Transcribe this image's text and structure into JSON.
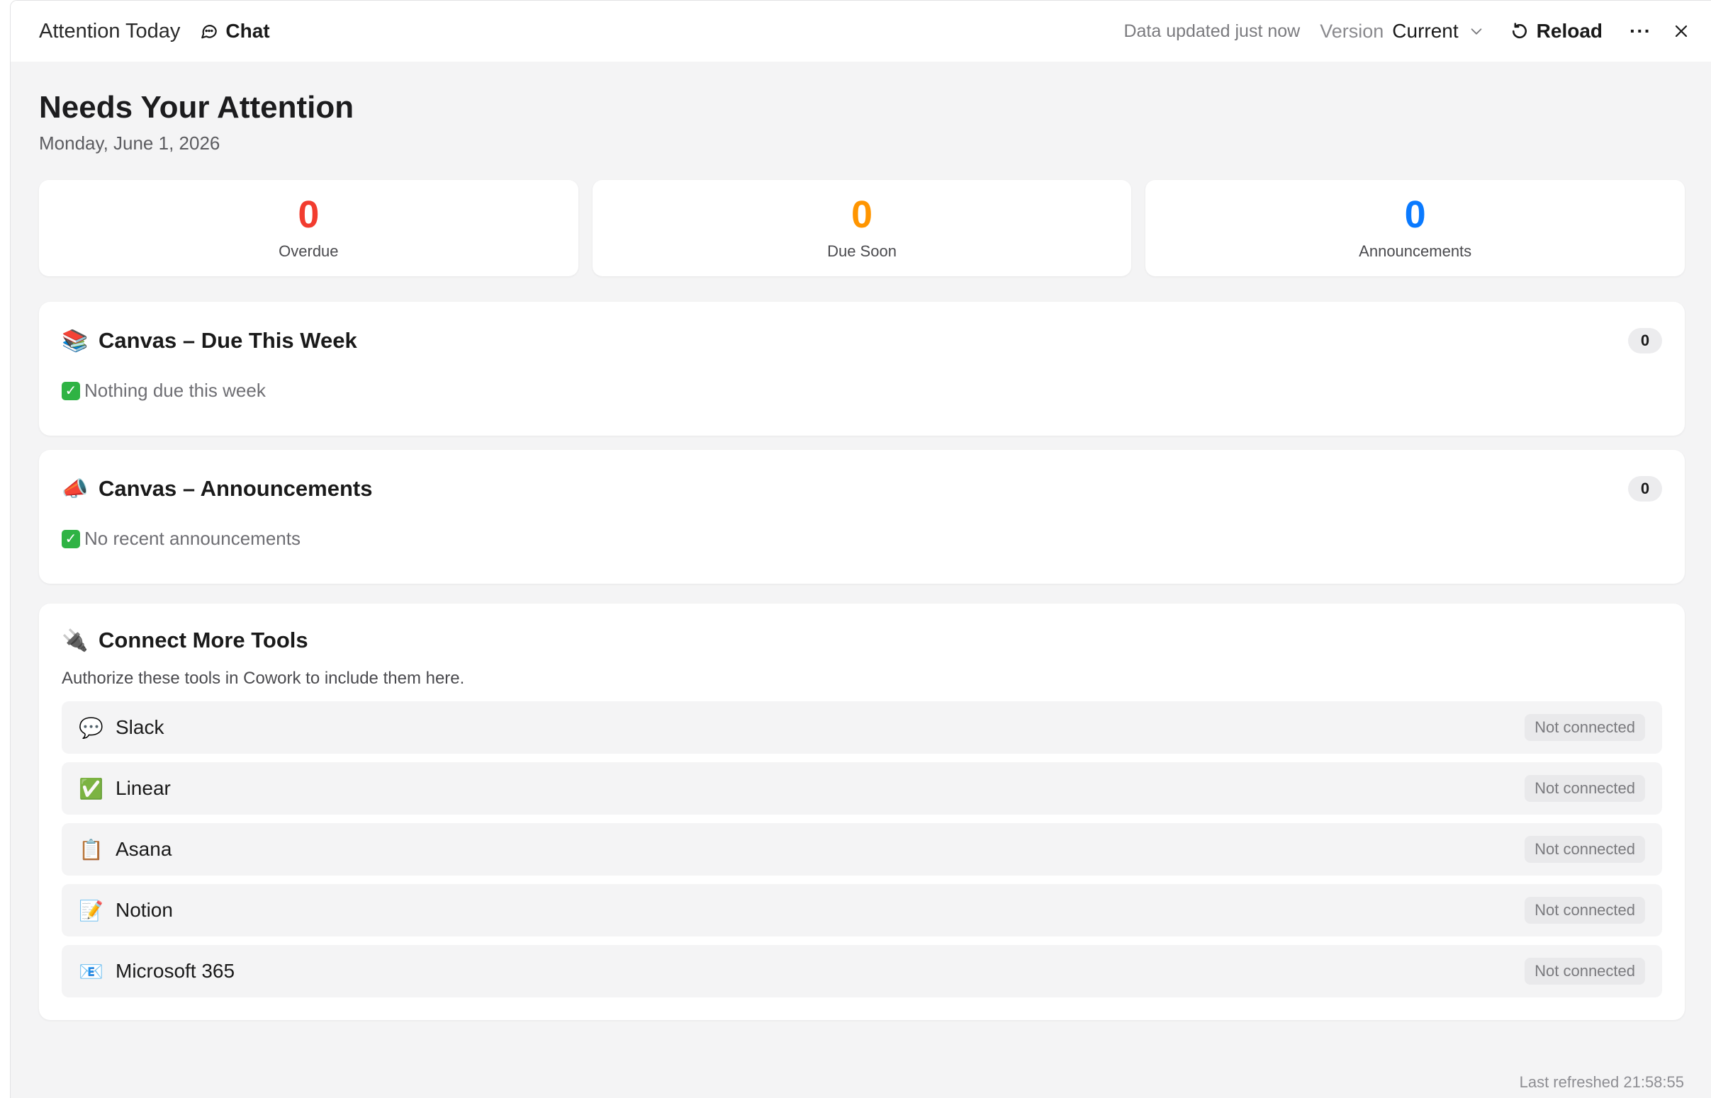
{
  "titlebar": {
    "app_title": "Attention Today",
    "chat_label": "Chat",
    "updated_text": "Data updated just now",
    "version_label": "Version",
    "version_value": "Current",
    "reload_label": "Reload",
    "more_label": "···"
  },
  "page": {
    "title": "Needs Your Attention",
    "date": "Monday, June 1, 2026"
  },
  "stats": [
    {
      "value": "0",
      "label": "Overdue",
      "color": "#f23c2f"
    },
    {
      "value": "0",
      "label": "Due Soon",
      "color": "#ff9500"
    },
    {
      "value": "0",
      "label": "Announcements",
      "color": "#0a7aff"
    }
  ],
  "due_card": {
    "emoji": "📚",
    "title": "Canvas – Due This Week",
    "count": "0",
    "empty_text": "Nothing due this week"
  },
  "announce_card": {
    "emoji": "📣",
    "title": "Canvas – Announcements",
    "count": "0",
    "empty_text": "No recent announcements"
  },
  "tools_card": {
    "emoji": "🔌",
    "title": "Connect More Tools",
    "subtitle": "Authorize these tools in Cowork to include them here.",
    "tools": [
      {
        "icon": "💬",
        "name": "Slack",
        "status": "Not connected"
      },
      {
        "icon": "✅",
        "name": "Linear",
        "status": "Not connected"
      },
      {
        "icon": "📋",
        "name": "Asana",
        "status": "Not connected"
      },
      {
        "icon": "📝",
        "name": "Notion",
        "status": "Not connected"
      },
      {
        "icon": "📧",
        "name": "Microsoft 365",
        "status": "Not connected"
      }
    ]
  },
  "footer": {
    "last_refreshed": "Last refreshed 21:58:55"
  },
  "icons": {
    "chat": "chat-bubble-icon",
    "chevron": "chevron-down-icon",
    "reload": "reload-icon",
    "close": "close-icon",
    "check": "checkmark-icon"
  }
}
